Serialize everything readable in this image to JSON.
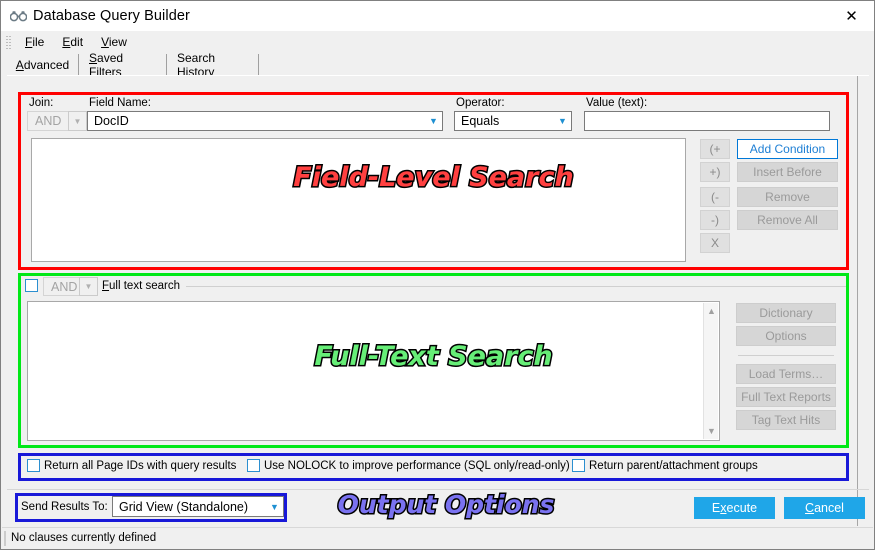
{
  "window": {
    "title": "Database Query Builder",
    "icon": "binoculars-icon",
    "close_label": "✕"
  },
  "menubar": {
    "items": [
      {
        "label": "File",
        "mnemonic": "F"
      },
      {
        "label": "Edit",
        "mnemonic": "E"
      },
      {
        "label": "View",
        "mnemonic": "V"
      }
    ]
  },
  "tabs": [
    {
      "label": "Advanced",
      "active": true
    },
    {
      "label": "Saved Filters",
      "active": false
    },
    {
      "label": "Search History",
      "active": false
    }
  ],
  "field_search": {
    "annotation": "Field-Level Search",
    "annotation_color": "#ff4040",
    "box_color": "#ff0000",
    "join_label": "Join:",
    "join_value": "AND",
    "field_name_label": "Field Name:",
    "field_name_value": "DocID",
    "operator_label": "Operator:",
    "operator_value": "Equals",
    "value_label": "Value (text):",
    "value_text": "",
    "paren_buttons": [
      "(+",
      "+)",
      "(-",
      "-)",
      "X"
    ],
    "action_buttons": [
      {
        "label": "Add Condition",
        "state": "default"
      },
      {
        "label": "Insert Before",
        "state": "disabled"
      },
      {
        "label": "Remove",
        "state": "disabled"
      },
      {
        "label": "Remove All",
        "state": "disabled"
      }
    ]
  },
  "full_text": {
    "annotation": "Full-Text Search",
    "annotation_color": "#66ee77",
    "box_color": "#00e817",
    "enabled_checkbox": false,
    "join_value": "AND",
    "group_label": "Full text search",
    "group_mnemonic": "F",
    "text_value": "",
    "buttons": [
      {
        "label": "Dictionary",
        "state": "disabled"
      },
      {
        "label": "Options",
        "state": "disabled"
      },
      {
        "label": "Load Terms…",
        "state": "disabled"
      },
      {
        "label": "Full Text Reports",
        "state": "disabled"
      },
      {
        "label": "Tag Text Hits",
        "state": "disabled"
      }
    ]
  },
  "output_options": {
    "annotation": "Output Options",
    "annotation_color": "#7a72f0",
    "box_color": "#1818d8",
    "checkboxes": [
      {
        "label": "Return all Page IDs with query results",
        "checked": false
      },
      {
        "label": "Use NOLOCK to improve performance (SQL only/read-only)",
        "checked": false
      },
      {
        "label": "Return parent/attachment groups",
        "checked": false
      }
    ],
    "send_results_label": "Send Results To:",
    "send_results_value": "Grid View (Standalone)"
  },
  "footer": {
    "execute_label": "Execute",
    "execute_mnemonic": "x",
    "cancel_label": "Cancel",
    "cancel_mnemonic": "C",
    "accent_color": "#1fa6e8"
  },
  "statusbar": {
    "text": "No clauses currently defined"
  },
  "icons": {
    "chevron_down": "▼",
    "chevron_up": "▲"
  }
}
